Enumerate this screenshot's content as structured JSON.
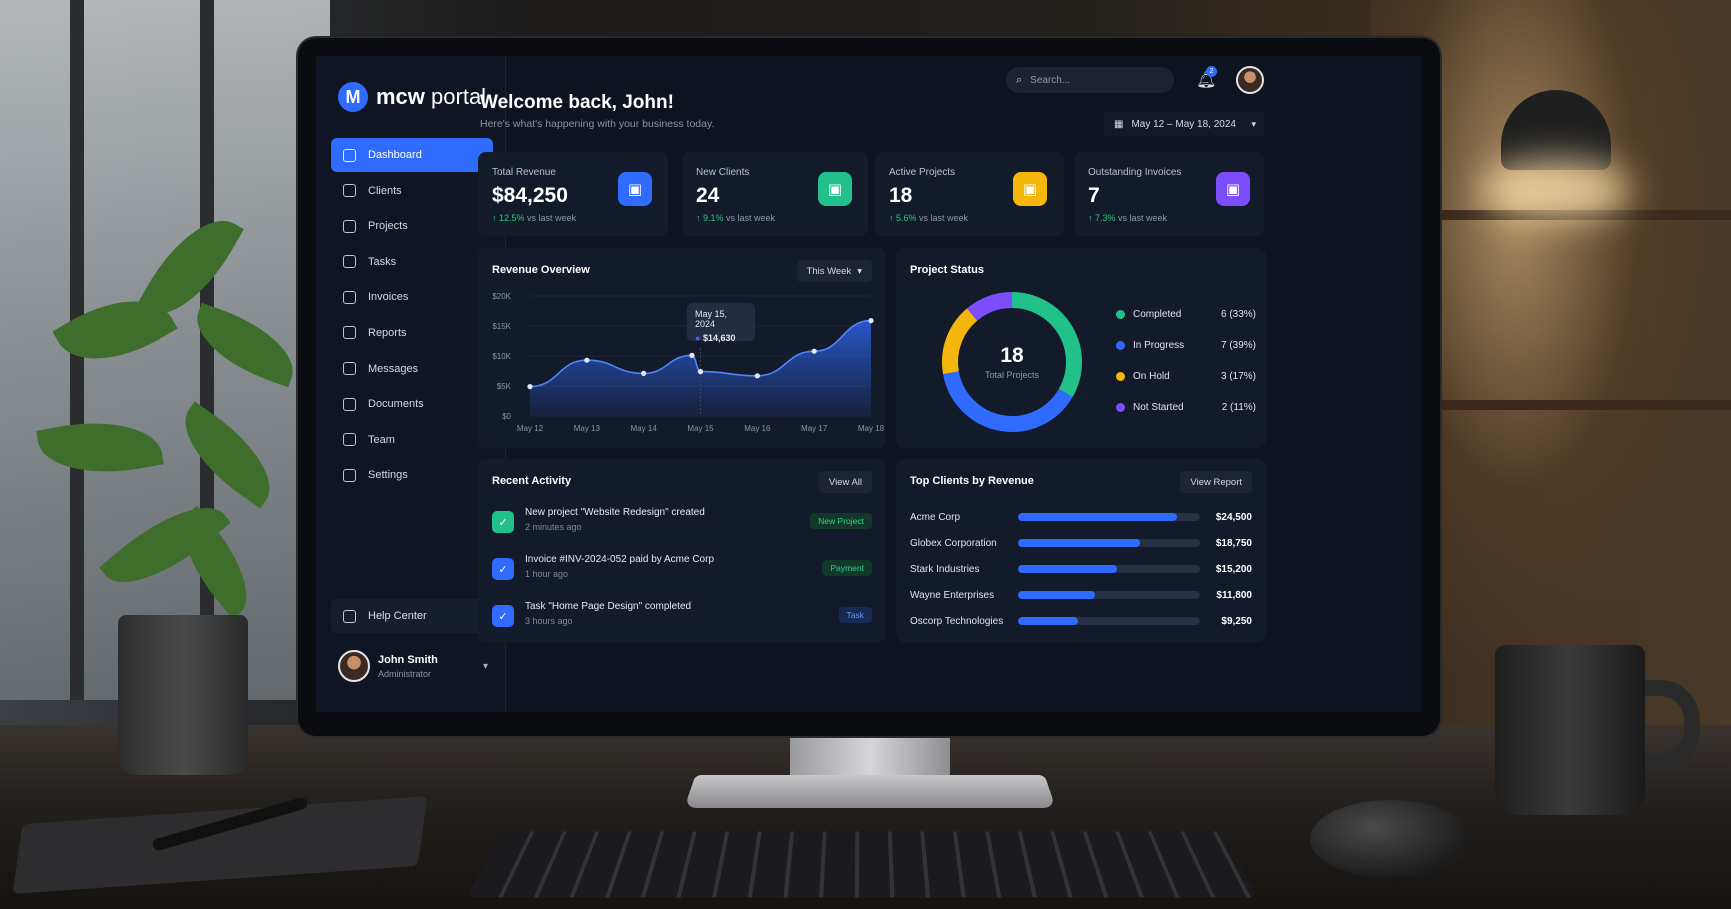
{
  "app": {
    "logo_mark": "M",
    "logo_bold": "mcw",
    "logo_light": " portal"
  },
  "sidebar": {
    "items": [
      {
        "label": "Dashboard",
        "icon": "home-icon",
        "active": true
      },
      {
        "label": "Clients",
        "icon": "user-icon"
      },
      {
        "label": "Projects",
        "icon": "folder-icon"
      },
      {
        "label": "Tasks",
        "icon": "checklist-icon"
      },
      {
        "label": "Invoices",
        "icon": "invoice-icon"
      },
      {
        "label": "Reports",
        "icon": "report-icon"
      },
      {
        "label": "Messages",
        "icon": "message-icon"
      },
      {
        "label": "Documents",
        "icon": "document-icon"
      },
      {
        "label": "Team",
        "icon": "team-icon"
      },
      {
        "label": "Settings",
        "icon": "gear-icon"
      }
    ],
    "help_label": "Help Center",
    "user": {
      "name": "John Smith",
      "role": "Administrator"
    }
  },
  "header": {
    "search_placeholder": "Search...",
    "notification_count": "2",
    "welcome": "Welcome back, John!",
    "subtitle": "Here's what's happening with your business today.",
    "date_range": "May 12 – May 18, 2024"
  },
  "stats": [
    {
      "label": "Total Revenue",
      "value": "$84,250",
      "delta": "12.5%",
      "delta_suffix": " vs last week",
      "color": "#2f6bff",
      "icon": "pen-icon"
    },
    {
      "label": "New Clients",
      "value": "24",
      "delta": "9.1%",
      "delta_suffix": " vs last week",
      "color": "#22c08a",
      "icon": "user-add-icon"
    },
    {
      "label": "Active Projects",
      "value": "18",
      "delta": "5.6%",
      "delta_suffix": " vs last week",
      "color": "#f5b60c",
      "icon": "project-icon"
    },
    {
      "label": "Outstanding Invoices",
      "value": "7",
      "delta": "7.3%",
      "delta_suffix": " vs last week",
      "color": "#7c4dff",
      "icon": "invoice-icon"
    }
  ],
  "revenue": {
    "title": "Revenue Overview",
    "period": "This Week",
    "tooltip": {
      "date": "May 15, 2024",
      "value": "$14,630"
    }
  },
  "chart_data": {
    "type": "area",
    "x": [
      "May 12",
      "May 13",
      "May 14",
      "May 15",
      "May 16",
      "May 17",
      "May 18"
    ],
    "x_ticks": [
      "May 12",
      "May 13",
      "May 14",
      "May 15",
      "May 16",
      "May 17",
      "May 18"
    ],
    "y_ticks": [
      "$0",
      "$5K",
      "$10K",
      "$15K",
      "$20K"
    ],
    "ylim": [
      0,
      20000
    ],
    "points": [
      {
        "x": 0,
        "y": 4900
      },
      {
        "x": 1.0,
        "y": 9300
      },
      {
        "x": 2.0,
        "y": 7100
      },
      {
        "x": 2.85,
        "y": 10100
      },
      {
        "x": 3.0,
        "y": 7400
      },
      {
        "x": 4.0,
        "y": 6700
      },
      {
        "x": 5.0,
        "y": 10800
      },
      {
        "x": 6.0,
        "y": 15900
      }
    ],
    "grid": true,
    "accent": "#2f6bff"
  },
  "project_status": {
    "title": "Project Status",
    "total": "18",
    "total_label": "Total Projects",
    "segments": [
      {
        "label": "Completed",
        "value": 6,
        "display": "6 (33%)",
        "color": "#22c08a"
      },
      {
        "label": "In Progress",
        "value": 7,
        "display": "7 (39%)",
        "color": "#2f6bff"
      },
      {
        "label": "On Hold",
        "value": 3,
        "display": "3 (17%)",
        "color": "#f5b60c"
      },
      {
        "label": "Not Started",
        "value": 2,
        "display": "2 (11%)",
        "color": "#7c4dff"
      }
    ]
  },
  "activity": {
    "title": "Recent Activity",
    "view_all": "View All",
    "items": [
      {
        "title": "New project \"Website Redesign\" created",
        "time": "2 minutes ago",
        "tag": "New Project",
        "tag_bg": "#12382b",
        "tag_fg": "#2fd08a",
        "icon_bg": "#22c08a"
      },
      {
        "title": "Invoice #INV-2024-052 paid by Acme Corp",
        "time": "1 hour ago",
        "tag": "Payment",
        "tag_bg": "#12382b",
        "tag_fg": "#2fd08a",
        "icon_bg": "#2f6bff"
      },
      {
        "title": "Task \"Home Page Design\" completed",
        "time": "3 hours ago",
        "tag": "Task",
        "tag_bg": "#172a4f",
        "tag_fg": "#6f9bff",
        "icon_bg": "#2f6bff"
      }
    ]
  },
  "top_clients": {
    "title": "Top Clients by Revenue",
    "view_report": "View Report",
    "items": [
      {
        "name": "Acme Corp",
        "value": "$24,500",
        "amount": 24500
      },
      {
        "name": "Globex Corporation",
        "value": "$18,750",
        "amount": 18750
      },
      {
        "name": "Stark Industries",
        "value": "$15,200",
        "amount": 15200
      },
      {
        "name": "Wayne Enterprises",
        "value": "$11,800",
        "amount": 11800
      },
      {
        "name": "Oscorp Technologies",
        "value": "$9,250",
        "amount": 9250
      }
    ]
  }
}
